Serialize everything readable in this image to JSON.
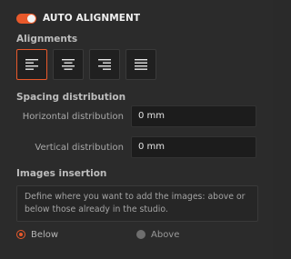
{
  "header": {
    "toggle_on": true,
    "title": "AUTO ALIGNMENT"
  },
  "alignments": {
    "label": "Alignments",
    "buttons": [
      {
        "icon": "align-left-icon",
        "active": true
      },
      {
        "icon": "align-center-icon",
        "active": false
      },
      {
        "icon": "align-right-icon",
        "active": false
      },
      {
        "icon": "align-justify-icon",
        "active": false
      }
    ]
  },
  "spacing": {
    "label": "Spacing distribution",
    "horizontal_label": "Horizontal distribution",
    "horizontal_value": "0 mm",
    "vertical_label": "Vertical distribution",
    "vertical_value": "0 mm"
  },
  "images_insertion": {
    "label": "Images insertion",
    "info": "Define where you want to add the images: above or below those already in the studio.",
    "options": [
      {
        "label": "Below",
        "selected": true
      },
      {
        "label": "Above",
        "selected": false
      }
    ]
  },
  "colors": {
    "accent": "#e8592b",
    "background": "#2b2b2b",
    "input_bg": "#1c1c1c"
  }
}
